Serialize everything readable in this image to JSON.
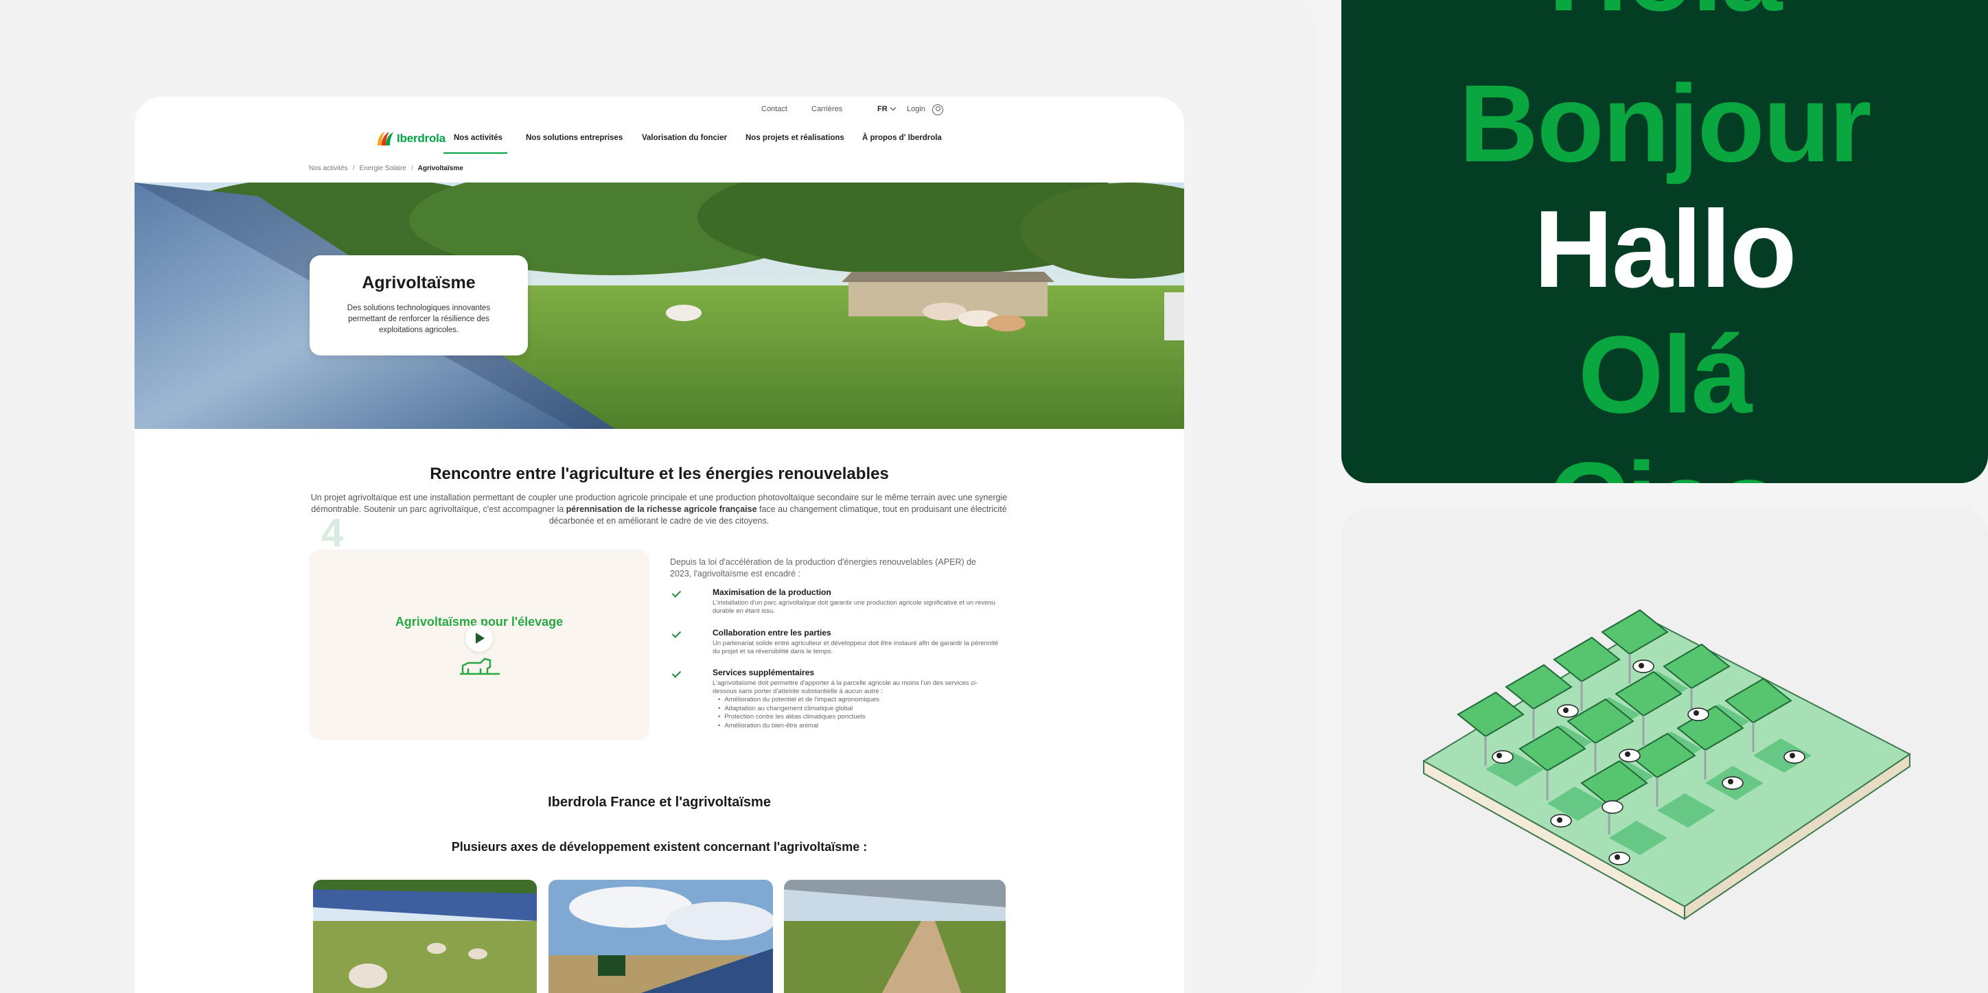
{
  "topbar": {
    "contact": "Contact",
    "careers": "Carrières",
    "lang": "FR",
    "login": "Login"
  },
  "logo": {
    "text": "Iberdrola"
  },
  "nav": {
    "items": [
      "Nos activités",
      "Nos solutions entreprises",
      "Valorisation du foncier",
      "Nos projets et réalisations",
      "À propos d' Iberdrola"
    ]
  },
  "breadcrumb": {
    "items": [
      "Nos activités",
      "Energie Solaire",
      "Agrivoltaïsme"
    ]
  },
  "hero": {
    "title": "Agrivoltaïsme",
    "subtitle": "Des solutions technologiques innovantes permettant de renforcer la résilience des exploitations agricoles."
  },
  "intro": {
    "title": "Rencontre entre l'agriculture et les énergies renouvelables",
    "text_before": "Un projet agrivoltaïque est une installation permettant de coupler une production agricole principale et une production photovoltaïque secondaire sur le même terrain avec une synergie démontrable. Soutenir un parc agrivoltaïque, c'est accompagner la ",
    "text_bold": "pérennisation de la richesse agricole française",
    "text_after": " face au changement climatique, tout en produisant une électricité décarbonée et en améliorant le cadre de vie des citoyens."
  },
  "video": {
    "title": "Agrivoltaïsme pour l'élevage",
    "ghost_number": "4"
  },
  "aper": {
    "intro": "Depuis la loi d'accélération de la production d'énergies renouvelables (APER) de 2023, l'agrivoltaïsme est encadré :",
    "items": [
      {
        "title": "Maximisation de la production",
        "text": "L'installation d'un parc agrivoltaïque doit garantir une production agricole significative et un revenu durable en étant issu."
      },
      {
        "title": "Collaboration entre les parties",
        "text": "Un partenariat solide entre agriculteur et développeur doit être instauré afin de garantir la pérennité du projet et sa réversibilité dans le temps."
      },
      {
        "title": "Services supplémentaires",
        "text": "L'agrivoltaïsme doit permettre d'apporter à la parcelle agricole au moins l'un des services ci-dessous sans porter d'atteinte substantielle à aucun autre :"
      }
    ],
    "bullets": [
      "Amélioration du potentiel et de l'impact agronomiques",
      "Adaptation au changement climatique global",
      "Protection contre les aléas climatiques ponctuels",
      "Amélioration du bien-être animal"
    ]
  },
  "section2": {
    "title": "Iberdrola France et l'agrivoltaïsme",
    "subtitle": "Plusieurs axes de développement existent concernant l'agrivoltaïsme :"
  },
  "greetings": [
    "Hola",
    "Bonjour",
    "Hallo",
    "Olá",
    "Ciao"
  ],
  "colors": {
    "brand_green": "#00a443",
    "dark_green": "#023d24",
    "greeting_green": "#0aa640"
  }
}
